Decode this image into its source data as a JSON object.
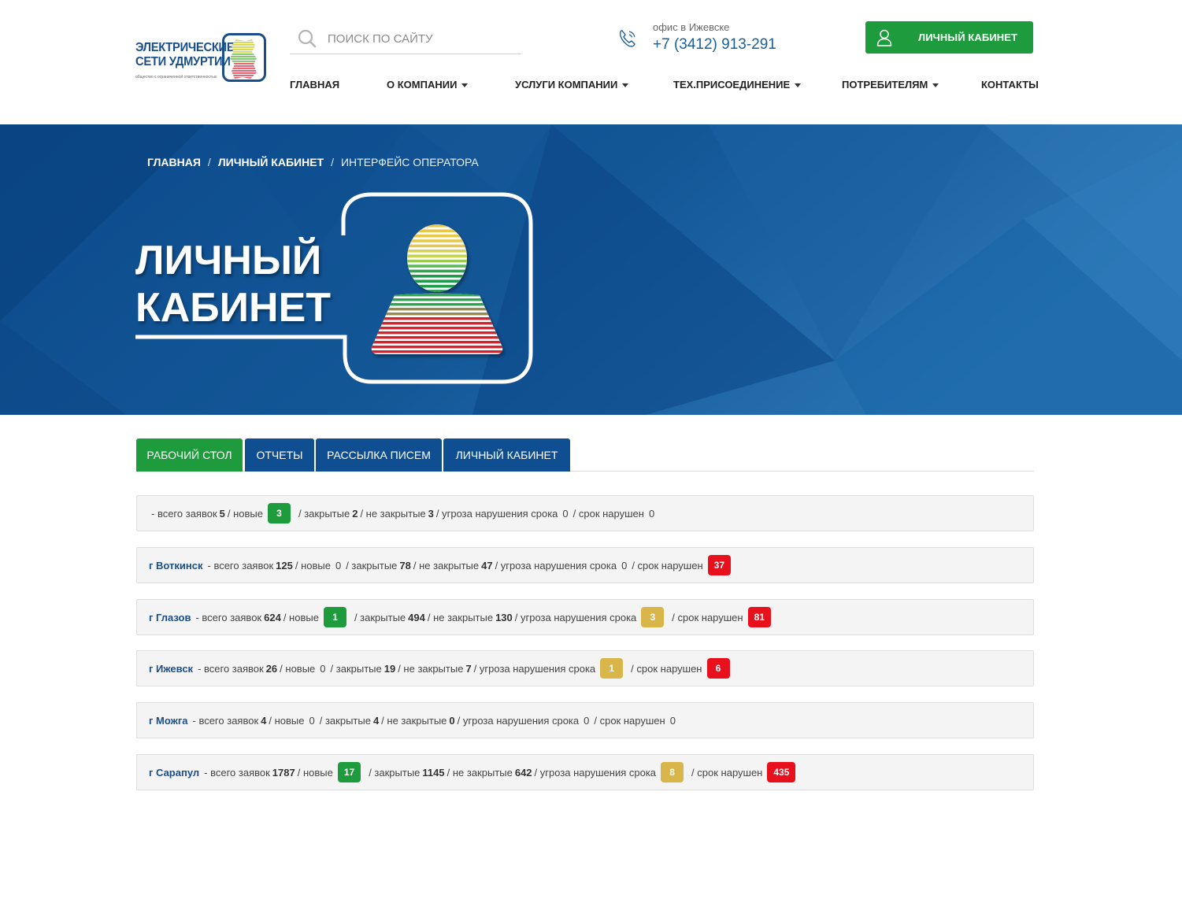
{
  "header": {
    "logo_line1": "ЭЛЕКТРИЧЕСКИЕ",
    "logo_line2": "СЕТИ УДМУРТИИ",
    "logo_sub": "общество с ограниченной ответственностью",
    "search_placeholder": "ПОИСК ПО САЙТУ",
    "office_label": "офис в Ижевске",
    "office_phone": "+7 (3412) 913-291",
    "cabinet_button": "ЛИЧНЫЙ КАБИНЕТ"
  },
  "nav": {
    "home": "ГЛАВНАЯ",
    "about": "О КОМПАНИИ",
    "services": "УСЛУГИ КОМПАНИИ",
    "tech": "ТЕХ.ПРИСОЕДИНЕНИЕ",
    "consumers": "ПОТРЕБИТЕЛЯМ",
    "contacts": "КОНТАКТЫ"
  },
  "breadcrumb": {
    "home": "ГЛАВНАЯ",
    "cabinet": "ЛИЧНЫЙ КАБИНЕТ",
    "current": "ИНТЕРФЕЙС ОПЕРАТОРА",
    "separator": "/"
  },
  "hero": {
    "title_line1": "ЛИЧНЫЙ",
    "title_line2": "КАБИНЕТ"
  },
  "tabs": {
    "desk": "РАБОЧИЙ СТОЛ",
    "reports": "ОТЧЕТЫ",
    "mailing": "РАССЫЛКА ПИСЕМ",
    "cabinet": "ЛИЧНЫЙ КАБИНЕТ"
  },
  "rows": [
    {
      "city": "",
      "prefix": "- всего заявок",
      "total": "5",
      "new_label": "/ новые",
      "new": "3",
      "closed_label": "/ закрытые",
      "closed": "2",
      "open_label": "/ не закрытые",
      "open": "3",
      "threat_label": "/ угроза нарушения срока",
      "threat": "0",
      "violated_label": "/ срок нарушен",
      "violated": "0"
    },
    {
      "city": "г Воткинск",
      "prefix": "- всего заявок",
      "total": "125",
      "new_label": "/ новые",
      "new": "0",
      "closed_label": "/ закрытые",
      "closed": "78",
      "open_label": "/ не закрытые",
      "open": "47",
      "threat_label": "/ угроза нарушения срока",
      "threat": "0",
      "violated_label": "/ срок нарушен",
      "violated": "37"
    },
    {
      "city": "г Глазов",
      "prefix": "- всего заявок",
      "total": "624",
      "new_label": "/ новые",
      "new": "1",
      "closed_label": "/ закрытые",
      "closed": "494",
      "open_label": "/ не закрытые",
      "open": "130",
      "threat_label": "/ угроза нарушения срока",
      "threat": "3",
      "violated_label": "/ срок нарушен",
      "violated": "81"
    },
    {
      "city": "г Ижевск",
      "prefix": "- всего заявок",
      "total": "26",
      "new_label": "/ новые",
      "new": "0",
      "closed_label": "/ закрытые",
      "closed": "19",
      "open_label": "/ не закрытые",
      "open": "7",
      "threat_label": "/ угроза нарушения срока",
      "threat": "1",
      "violated_label": "/ срок нарушен",
      "violated": "6"
    },
    {
      "city": "г Можга",
      "prefix": "- всего заявок",
      "total": "4",
      "new_label": "/ новые",
      "new": "0",
      "closed_label": "/ закрытые",
      "closed": "4",
      "open_label": "/ не закрытые",
      "open": "0",
      "threat_label": "/ угроза нарушения срока",
      "threat": "0",
      "violated_label": "/ срок нарушен",
      "violated": "0"
    },
    {
      "city": "г Сарапул",
      "prefix": "- всего заявок",
      "total": "1787",
      "new_label": "/ новые",
      "new": "17",
      "closed_label": "/ закрытые",
      "closed": "1145",
      "open_label": "/ не закрытые",
      "open": "642",
      "threat_label": "/ угроза нарушения срока",
      "threat": "8",
      "violated_label": "/ срок нарушен",
      "violated": "435"
    }
  ],
  "icons": {
    "search": "search-icon",
    "phone": "phone-icon",
    "user": "user-icon",
    "caret": "caret-down-icon"
  },
  "colors": {
    "brand_blue": "#0f4f91",
    "brand_green": "#1e9b3c",
    "badge_red": "#e8101c",
    "badge_yellow": "#d8b64a"
  }
}
